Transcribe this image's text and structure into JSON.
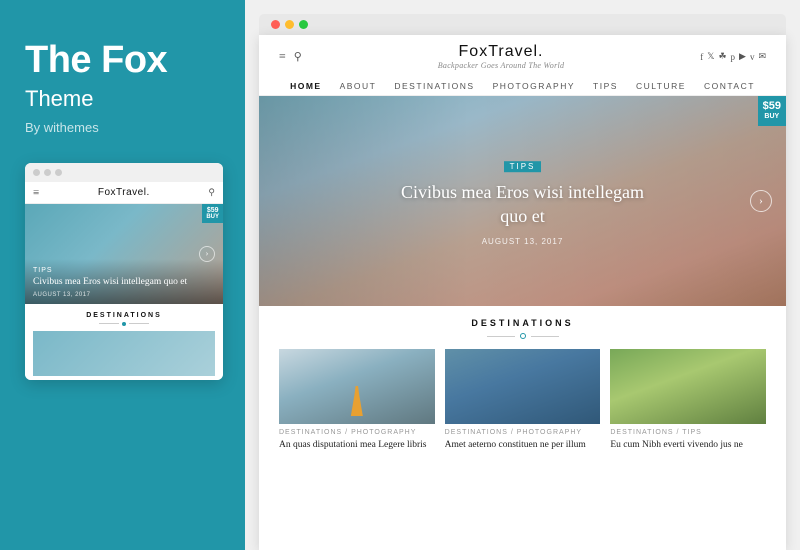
{
  "left": {
    "title": "The Fox",
    "subtitle": "Theme",
    "by": "By withemes"
  },
  "mini": {
    "logo": "FoxTravel.",
    "logo_suffix": ".",
    "hero_tag": "TIPS",
    "hero_title": "Civibus mea Eros wisi intellegam quo et",
    "hero_date": "AUGUST 13, 2017",
    "destinations_label": "DESTINATIONS",
    "buy_price": "$59",
    "buy_sub": "BUY"
  },
  "browser": {
    "dots": [
      "red",
      "yellow",
      "green"
    ]
  },
  "site": {
    "logo": "FoxTravel",
    "logo_dot": ".",
    "tagline": "Backpacker Goes Around The World",
    "nav": [
      "HOME",
      "ABOUT",
      "DESTINATIONS",
      "PHOTOGRAPHY",
      "TIPS",
      "CULTURE",
      "CONTACT"
    ],
    "hero": {
      "tag": "TIPS",
      "title": "Civibus mea Eros wisi intellegam quo et",
      "date": "AUGUST 13, 2017"
    },
    "buy": {
      "price": "$59",
      "sub": "BUY"
    },
    "destinations_heading": "DESTINATIONS",
    "cards": [
      {
        "tag": "DESTINATIONS",
        "tag2": "PHOTOGRAPHY",
        "title": "An quas disputationi mea Legere libris"
      },
      {
        "tag": "DESTINATIONS",
        "tag2": "PHOTOGRAPHY",
        "title": "Amet aeterno constituen ne per illum"
      },
      {
        "tag": "DESTINATIONS",
        "tag2": "TIPS",
        "title": "Eu cum Nibh everti vivendo jus ne"
      }
    ]
  }
}
